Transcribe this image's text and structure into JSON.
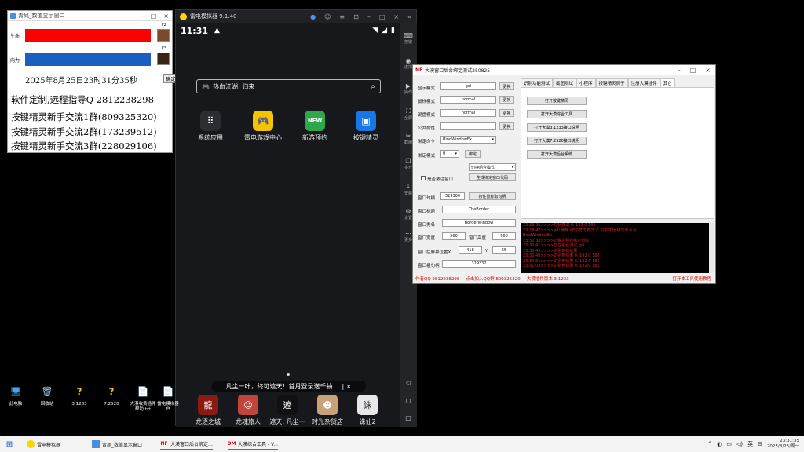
{
  "left_window": {
    "title": "青凤_数值显示窗口",
    "hp_label": "生命",
    "mp_label": "内力",
    "f2_label": "F2",
    "f3_label": "F3",
    "hp_color": "#ff0000",
    "mp_color": "#1a5fc0",
    "datetime": "2025年8月25日23时31分35秒",
    "confirm_label": "确定",
    "line1": "软件定制,远程指导Q 2812238298",
    "line2": "按键精灵新手交流1群(809325320)",
    "line3": "按键精灵新手交流2群(173239512)",
    "line4": "按键精灵新手交流3群(228029106)"
  },
  "emulator": {
    "title": "雷电模拟器 9.1.40",
    "time": "11:31",
    "search_text": "热血江湖: 归来",
    "apps": [
      "系统应用",
      "雷电游戏中心",
      "新游预约",
      "按键精灵"
    ],
    "new_badge": "NEW",
    "banner": "凡尘一叶，终可遮天！首月登录送千抽！",
    "dock": [
      "龙逐之城",
      "龙魂旅人",
      "遮天: 凡尘一",
      "时光杂货店",
      "诛仙2"
    ],
    "side_labels": [
      "按键",
      "虚拟",
      "操作",
      "全屏",
      "截图",
      "多开",
      "安装",
      "设置",
      "更多"
    ]
  },
  "tool": {
    "title": "大漠窗口后台绑定测试250825",
    "fields": {
      "display_mode_label": "显示模式",
      "display_mode_value": "gdi",
      "mouse_mode_label": "鼠标模式",
      "mouse_mode_value": "normal",
      "keyboard_mode_label": "键盘模式",
      "keyboard_mode_value": "normal",
      "public_attr_label": "公共属性",
      "change_label": "更换",
      "bind_cmd_label": "绑定命令",
      "bind_cmd_value": "BindWindowEx",
      "bind_mode_label": "绑定模式",
      "bind_mode_value": "0",
      "bind_btn": "绑定",
      "switch_mode": "切换后台模式",
      "is_bg_label": "是否激活窗口",
      "gen_code": "生成绑定窗口代码",
      "hwnd_label": "窗口句柄",
      "hwnd_value": "329300",
      "get_hwnd_btn": "按住鼠标取句柄",
      "win_title_label": "窗口标题",
      "win_title_value": "TheBorder",
      "class_label": "窗口类名",
      "class_value": "BorderWindow",
      "width_label": "窗口宽度",
      "width_value": "560",
      "height_label": "窗口高度",
      "height_value": "960",
      "pos_label": "窗口在屏幕位置X",
      "pos_x": "418",
      "y_label": "Y",
      "pos_y": "55",
      "parent_label": "窗口祖句柄",
      "parent_value": "329332"
    },
    "tabs": [
      "识别功能测试",
      "截图测试",
      "小程序",
      "按键精灵例子",
      "注册大漠插件",
      "其它"
    ],
    "panel_buttons": [
      "打开按键精灵",
      "打开大漠综合工具",
      "打开大漠3.1233接口说明",
      "打开大漠7.2520接口说明",
      "打开大漠后台系统"
    ],
    "log": [
      "23:29:36>>>>句柄获取 0, 169 0 166",
      "23:29:47>>>>gdi 使用 绑定模式 模式 0  识别成功 绑定命令为",
      "BindWindowEx",
      "23:30:38>>>>正确的后台绑定测试",
      "23:30:41>>>>正在后台测试 gdi",
      "23:30:45>>>>识别到的结果",
      "23:30:48>>>>识别到结果 0, 192 0 188",
      "23:30:55>>>>识别到结果 0, 182 0 185",
      "23:31:03>>>>识别到结果 0, 182 0 185"
    ],
    "status": [
      "作者QQ 2812238298",
      "点击加入QQ群 809325320",
      "大漠插件版本 3.1233"
    ],
    "help": "打开本工具使用教程"
  },
  "desktop_icons": [
    "此电脑",
    "回收站",
    "3.1233",
    "7.2520",
    "大漠收费插件帮助.txt",
    "雷电模拟器户"
  ],
  "taskbar": {
    "items": [
      "雷电模拟器",
      "青凤_数值显示窗口",
      "大漠窗口后台绑定...",
      "大漠综合工具 - V..."
    ],
    "ime": "英",
    "time": "23:31:35",
    "date": "2025/8/25/周一"
  }
}
